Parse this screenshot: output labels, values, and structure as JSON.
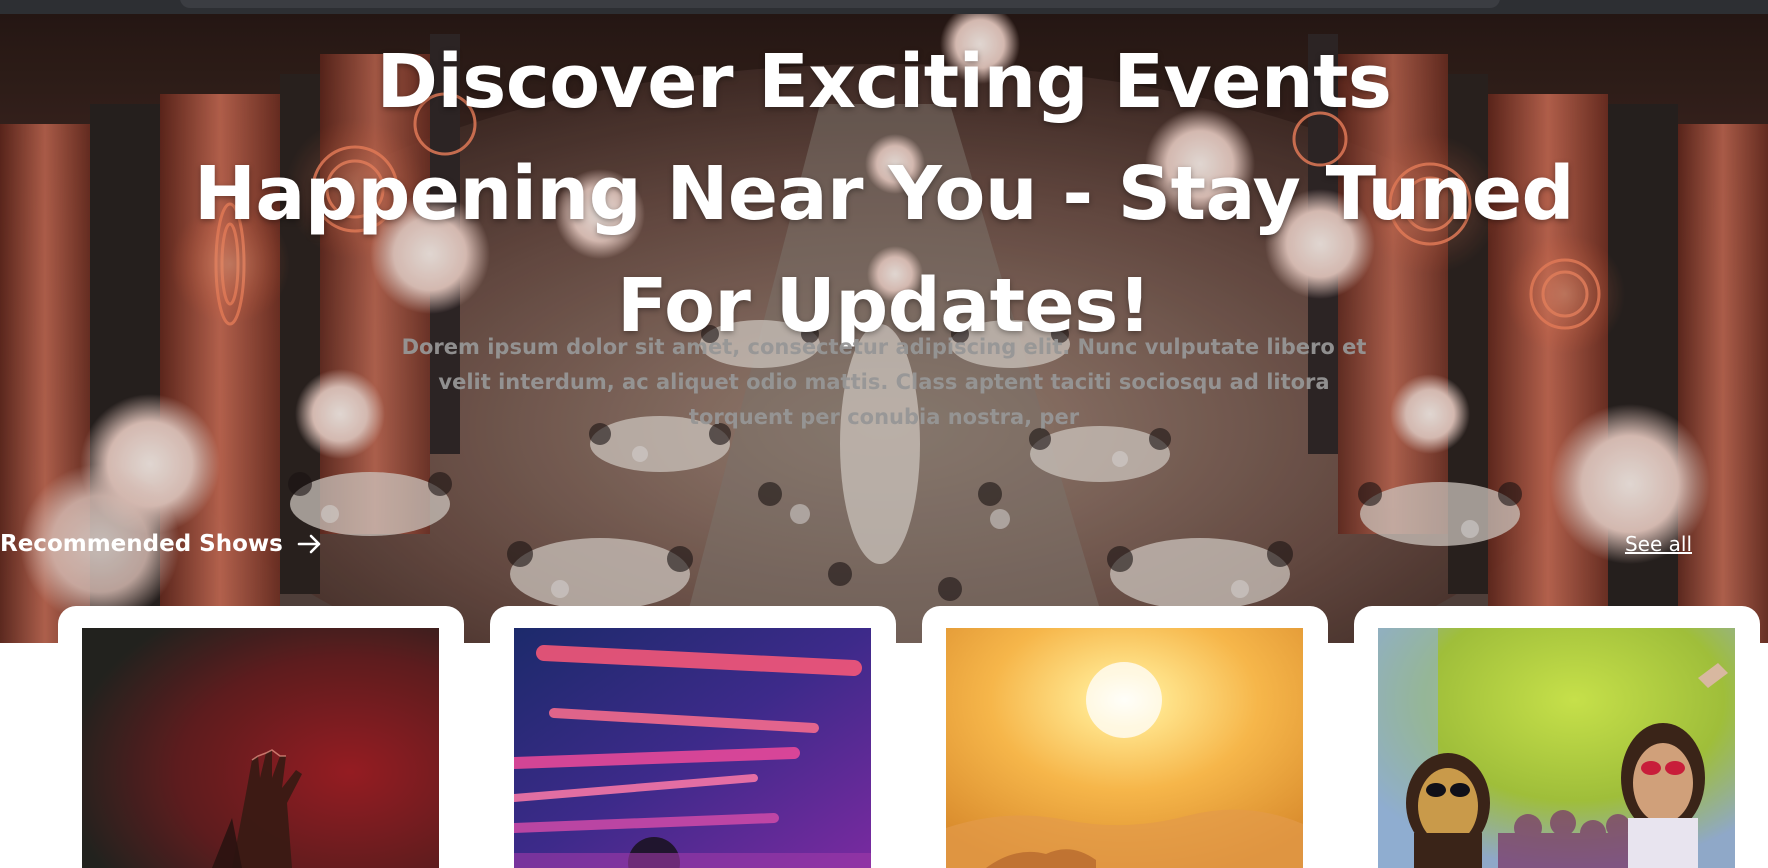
{
  "hero": {
    "title": "Discover Exciting Events Happening Near You - Stay Tuned For Updates!",
    "description": "Dorem ipsum dolor sit amet, consectetur adipiscing elit. Nunc vulputate libero et velit interdum, ac aliquet odio mattis. Class aptent taciti sociosqu ad litora torquent per conubia nostra, per",
    "background_image": "banquet-hall-event-photo"
  },
  "recommended": {
    "title": "Recommended Shows",
    "arrow_icon": "arrow-right-icon",
    "see_all_label": "See all"
  },
  "cards": [
    {
      "image": "concert-hands-red-smoke"
    },
    {
      "image": "stage-lights-blue-pink"
    },
    {
      "image": "golden-sunset"
    },
    {
      "image": "holi-color-festival"
    }
  ],
  "colors": {
    "hero_text": "#ffffff",
    "description_text": "#969696",
    "card_background": "#ffffff",
    "chrome": "#2d2f33"
  }
}
